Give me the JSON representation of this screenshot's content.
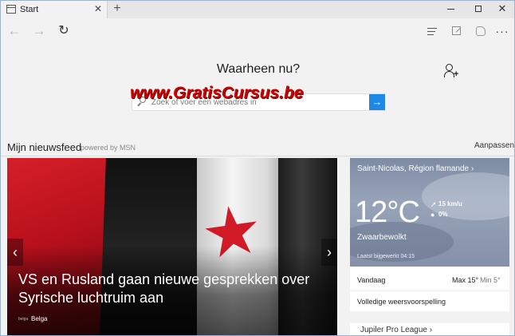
{
  "window": {
    "tab_title": "Start",
    "tab_close": "✕",
    "new_tab": "+",
    "minimize": "",
    "maximize": "",
    "close": "✕"
  },
  "nav": {
    "back": "←",
    "forward": "→",
    "refresh": "↻",
    "more": "···"
  },
  "start": {
    "heading": "Waarheen nu?",
    "search_placeholder": "Zoek of voer een webadres in",
    "go": "→",
    "watermark": "www.GratisCursus.be"
  },
  "feed": {
    "title": "Mijn nieuwsfeed",
    "powered": "powered by MSN",
    "customize": "Aanpassen"
  },
  "hero": {
    "headline": "VS en Rusland gaan nieuwe gesprekken over Syrische luchtruim aan",
    "source_logo": "belga",
    "source": "Belga",
    "prev": "‹",
    "next": "›",
    "dots": 5,
    "active_dot": 1
  },
  "weather": {
    "location": "Saint-Nicolas, Région flamande ›",
    "temperature": "12°C",
    "wind": "15 km/u",
    "precipitation": "0%",
    "condition": "Zwaarbewolkt",
    "updated": "Laatst bijgewerkt 04:15",
    "today_label": "Vandaag",
    "max": "Max 15°",
    "min": "Min 5°",
    "full_forecast": "Volledige weersvoorspelling"
  },
  "league": {
    "title": "Jupiler Pro League ›"
  },
  "colors": {
    "accent": "#1e88e5",
    "watermark": "#d10000"
  }
}
